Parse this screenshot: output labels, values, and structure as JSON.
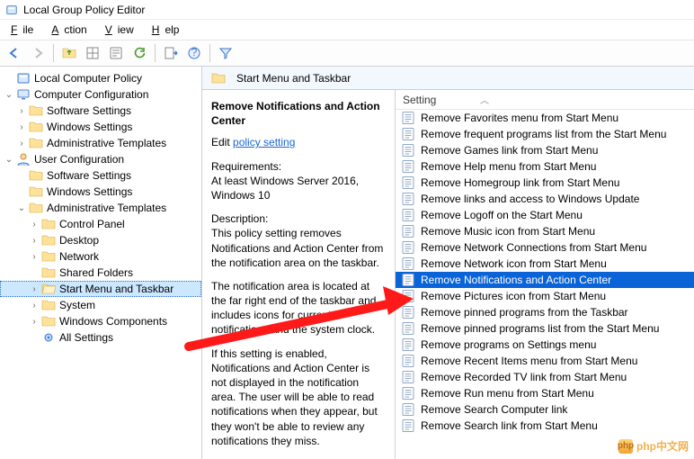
{
  "window": {
    "title": "Local Group Policy Editor"
  },
  "menubar": {
    "file": "File",
    "action": "Action",
    "view": "View",
    "help": "Help"
  },
  "tree": {
    "root": "Local Computer Policy",
    "cc": {
      "label": "Computer Configuration",
      "children": [
        "Software Settings",
        "Windows Settings",
        "Administrative Templates"
      ]
    },
    "uc": {
      "label": "User Configuration",
      "children": {
        "ss": "Software Settings",
        "ws": "Windows Settings",
        "at": {
          "label": "Administrative Templates",
          "children": [
            "Control Panel",
            "Desktop",
            "Network",
            "Shared Folders",
            "Start Menu and Taskbar",
            "System",
            "Windows Components",
            "All Settings"
          ],
          "selectedIndex": 4
        }
      }
    }
  },
  "location": {
    "label": "Start Menu and Taskbar"
  },
  "desc": {
    "heading": "Remove Notifications and Action Center",
    "editPrefix": "Edit ",
    "editLink": "policy setting",
    "reqLabel": "Requirements:",
    "reqText": "At least Windows Server 2016, Windows 10",
    "descLabel": "Description:",
    "p1": "This policy setting removes Notifications and Action Center from the notification area on the taskbar.",
    "p2": "The notification area is located at the far right end of the taskbar and includes icons for current notifications and the system clock.",
    "p3": "If this setting is enabled, Notifications and Action Center is not displayed in the notification area. The user will be able to read notifications when they appear, but they won't be able to review any notifications they miss."
  },
  "list": {
    "header": "Setting",
    "selectedIndex": 10,
    "items": [
      "Remove Favorites menu from Start Menu",
      "Remove frequent programs list from the Start Menu",
      "Remove Games link from Start Menu",
      "Remove Help menu from Start Menu",
      "Remove Homegroup link from Start Menu",
      "Remove links and access to Windows Update",
      "Remove Logoff on the Start Menu",
      "Remove Music icon from Start Menu",
      "Remove Network Connections from Start Menu",
      "Remove Network icon from Start Menu",
      "Remove Notifications and Action Center",
      "Remove Pictures icon from Start Menu",
      "Remove pinned programs from the Taskbar",
      "Remove pinned programs list from the Start Menu",
      "Remove programs on Settings menu",
      "Remove Recent Items menu from Start Menu",
      "Remove Recorded TV link from Start Menu",
      "Remove Run menu from Start Menu",
      "Remove Search Computer link",
      "Remove Search link from Start Menu"
    ]
  },
  "watermark": {
    "text": "php中文网"
  }
}
